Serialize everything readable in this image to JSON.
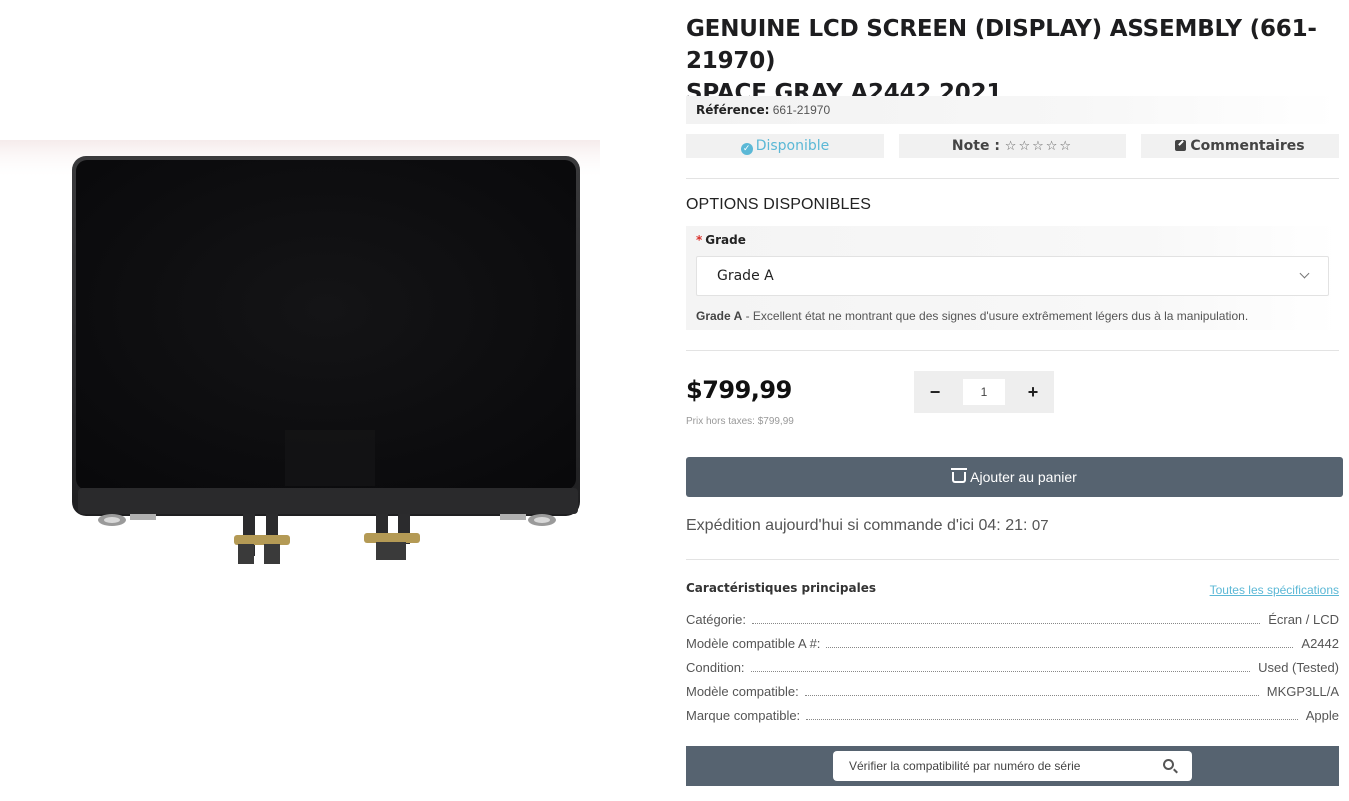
{
  "product": {
    "title_line1": "GENUINE LCD SCREEN (DISPLAY) ASSEMBLY (661-21970)",
    "title_line2": "SPACE GRAY A2442 2021",
    "reference_label": "Référence:",
    "reference_value": "661-21970"
  },
  "status": {
    "availability": "Disponible",
    "rating_label": "Note :",
    "rating_stars": "☆☆☆☆☆",
    "rating_value": 0,
    "comments_label": "Commentaires"
  },
  "options": {
    "title": "OPTIONS DISPONIBLES",
    "grade_required_mark": "*",
    "grade_label": "Grade",
    "grade_selected": "Grade A",
    "grade_desc_name": "Grade A",
    "grade_desc_text": " - Excellent état ne montrant que des signes d'usure extrêmement légers dus à la manipulation."
  },
  "pricing": {
    "price": "$799,99",
    "price_ex_tax": "Prix hors taxes: $799,99",
    "quantity": "1",
    "minus": "−",
    "plus": "+",
    "add_to_cart": "Ajouter au panier"
  },
  "shipping": {
    "text": "Expédition aujourd'hui si commande d'ici",
    "hours": "04",
    "minutes": "21",
    "seconds": "07"
  },
  "features": {
    "title": "Caractéristiques principales",
    "all_specs_link": "Toutes les spécifications",
    "specs": [
      {
        "key": "Catégorie:",
        "value": "Écran / LCD"
      },
      {
        "key": "Modèle compatible A #:",
        "value": "A2442"
      },
      {
        "key": "Condition:",
        "value": "Used (Tested)"
      },
      {
        "key": "Modèle compatible:",
        "value": "MKGP3LL/A"
      },
      {
        "key": "Marque compatible:",
        "value": "Apple"
      }
    ]
  },
  "serial_check": {
    "placeholder": "Vérifier la compatibilité par numéro de série"
  },
  "colors": {
    "accent_blue": "#5bb8d6",
    "dark_button": "#566370",
    "required_red": "#d9302b"
  }
}
